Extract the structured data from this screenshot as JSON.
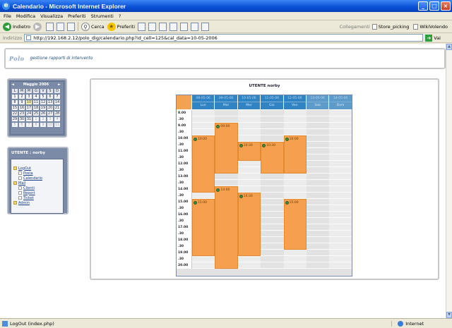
{
  "window": {
    "title": "Calendario - Microsoft Internet Explorer"
  },
  "menu": [
    "File",
    "Modifica",
    "Visualizza",
    "Preferiti",
    "Strumenti",
    "?"
  ],
  "toolbar": {
    "back": "Indietro",
    "search": "Cerca",
    "favorites": "Preferiti",
    "links_label": "Collegamenti",
    "link1": "Store_picking",
    "link2": "WikiVolendo"
  },
  "address": {
    "label": "Indirizzo",
    "url": "http://192.168.2.12/polo_dig/calendario.php?id_cell=125&cal_data=10-05-2006",
    "go": "Vai"
  },
  "header": {
    "logo": "Polo",
    "subtitle": "gestione rapporti di intervento"
  },
  "calendar": {
    "month": "Maggio 2006",
    "weekdays": [
      "L",
      "M",
      "M",
      "G",
      "V",
      "S",
      "D"
    ],
    "rows": [
      [
        "1",
        "2",
        "3",
        "4",
        "5",
        "6",
        "7"
      ],
      [
        "8",
        "9",
        "10",
        "11",
        "12",
        "13",
        "14"
      ],
      [
        "15",
        "16",
        "17",
        "18",
        "19",
        "20",
        "21"
      ],
      [
        "22",
        "23",
        "24",
        "25",
        "26",
        "27",
        "28"
      ],
      [
        "29",
        "30",
        "31",
        "1",
        "2",
        "3",
        "4"
      ],
      [
        "5",
        "6",
        "7",
        "8",
        "9",
        "10",
        "11"
      ]
    ],
    "selected": "10"
  },
  "user_panel": {
    "title": "UTENTE : norby",
    "items": [
      "LogOut",
      "Posta",
      "Calendario",
      "Mail",
      "Clienti",
      "Report",
      "Ticket",
      "Admin"
    ]
  },
  "schedule": {
    "title": "UTENTE norby",
    "days": [
      {
        "date": "08-05-06",
        "label": "Lun"
      },
      {
        "date": "09-05-06",
        "label": "Mar"
      },
      {
        "date": "10-05-06",
        "label": "Mer"
      },
      {
        "date": "11-05-06",
        "label": "Gio"
      },
      {
        "date": "12-05-06",
        "label": "Ven"
      },
      {
        "date": "13-05-06",
        "label": "Sab"
      },
      {
        "date": "14-05-06",
        "label": "Dom"
      }
    ],
    "times": [
      "8.00",
      ".30",
      "9.00",
      ".30",
      "10.00",
      ".30",
      "11.00",
      ".30",
      "12.00",
      ".30",
      "13.00",
      ".30",
      "14.00",
      ".30",
      "15.00",
      ".30",
      "16.00",
      ".30",
      "17.00",
      ".30",
      "18.00",
      ".30",
      "19.00",
      ".30",
      "20.00"
    ],
    "events": [
      {
        "day": 1,
        "start": 9.0,
        "end": 13.0,
        "label": "09:00"
      },
      {
        "day": 0,
        "start": 10.0,
        "end": 14.5,
        "label": "10:00"
      },
      {
        "day": 4,
        "start": 10.0,
        "end": 13.0,
        "label": "10:00"
      },
      {
        "day": 2,
        "start": 10.5,
        "end": 12.0,
        "label": "10:30"
      },
      {
        "day": 3,
        "start": 10.5,
        "end": 13.0,
        "label": "10:30"
      },
      {
        "day": 1,
        "start": 14.0,
        "end": 20.5,
        "label": "14:00"
      },
      {
        "day": 2,
        "start": 14.5,
        "end": 19.5,
        "label": "14:30"
      },
      {
        "day": 0,
        "start": 15.0,
        "end": 19.5,
        "label": "15:00"
      },
      {
        "day": 4,
        "start": 15.0,
        "end": 19.0,
        "label": "15:00"
      }
    ]
  },
  "status": {
    "left": "LogOut (index.php)",
    "zone": "Internet"
  }
}
